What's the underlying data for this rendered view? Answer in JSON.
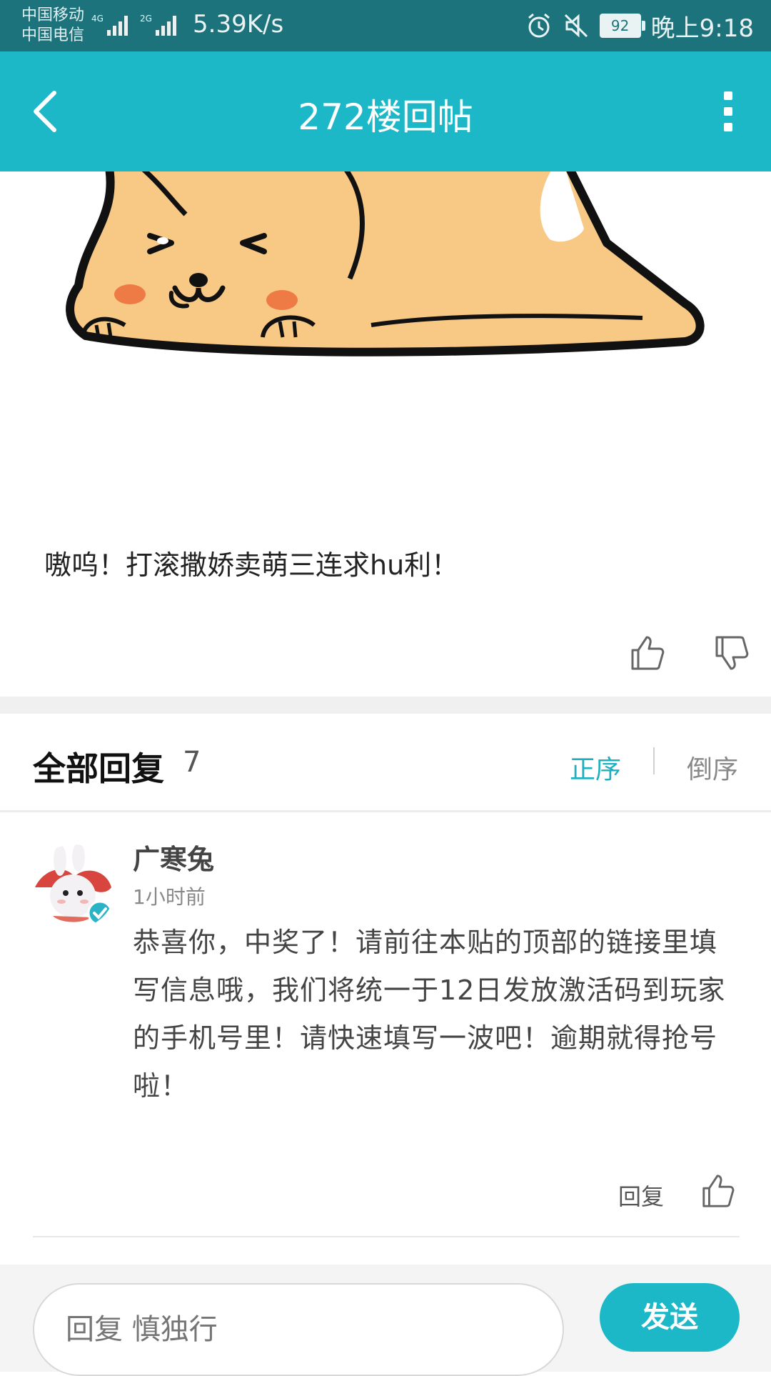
{
  "status_bar": {
    "carrier_1": "中国移动",
    "carrier_2": "中国电信",
    "network_1": "4G",
    "network_2": "2G",
    "net_speed": "5.39K/s",
    "battery": "92",
    "time": "晚上9:18",
    "icons": [
      "alarm-icon",
      "mute-icon",
      "battery-icon"
    ]
  },
  "header": {
    "title": "272楼回帖",
    "back_icon": "chevron-left-icon",
    "more_icon": "more-vertical-icon"
  },
  "post": {
    "image": "shiba-dog-sticker",
    "text": "嗷呜！打滚撒娇卖萌三连求hu利！",
    "actions": [
      "thumbs-up-icon",
      "thumbs-down-icon"
    ]
  },
  "replies_section": {
    "title": "全部回复",
    "count": "7",
    "sort_asc": "正序",
    "sort_desc": "倒序"
  },
  "reply": {
    "avatar": "rabbit-avatar",
    "username": "广寒兔",
    "time": "1小时前",
    "body": "恭喜你，中奖了！请前往本贴的顶部的链接里填写信息哦，我们将统一于12日发放激活码到玩家的手机号里！请快速填写一波吧！逾期就得抢号啦！",
    "reply_label": "回复"
  },
  "bottom_bar": {
    "placeholder": "回复 慎独行",
    "send_label": "发送"
  },
  "colors": {
    "accent": "#1cb8c7",
    "status_bar": "#1d737c"
  }
}
